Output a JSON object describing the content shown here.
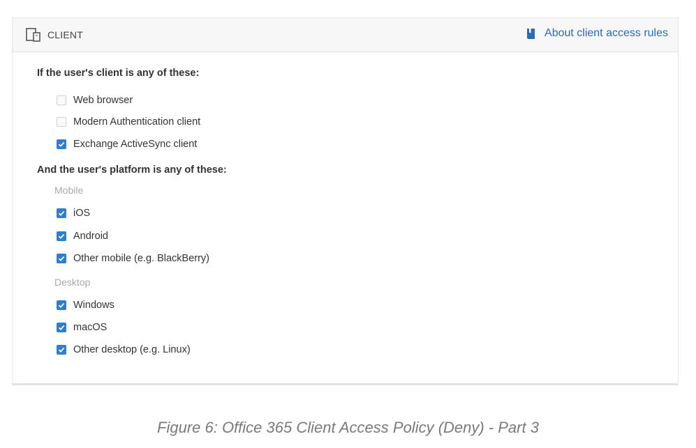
{
  "panel": {
    "title": "CLIENT",
    "about_link": "About client access rules",
    "client_section_title": "If the user's client is any of these:",
    "clients": [
      {
        "label": "Web browser",
        "checked": false
      },
      {
        "label": "Modern Authentication client",
        "checked": false
      },
      {
        "label": "Exchange ActiveSync client",
        "checked": true
      }
    ],
    "platform_section_title": "And the user's platform is any of these:",
    "mobile_label": "Mobile",
    "mobile": [
      {
        "label": "iOS",
        "checked": true
      },
      {
        "label": "Android",
        "checked": true
      },
      {
        "label": "Other mobile (e.g. BlackBerry)",
        "checked": true
      }
    ],
    "desktop_label": "Desktop",
    "desktop": [
      {
        "label": "Windows",
        "checked": true
      },
      {
        "label": "macOS",
        "checked": true
      },
      {
        "label": "Other desktop (e.g. Linux)",
        "checked": true
      }
    ]
  },
  "caption": "Figure 6: Office 365 Client Access Policy (Deny) - Part 3",
  "colors": {
    "accent": "#2f7fd0",
    "link": "#2a6ab8"
  },
  "icons": {
    "client": "device-icon",
    "about": "book-icon"
  }
}
